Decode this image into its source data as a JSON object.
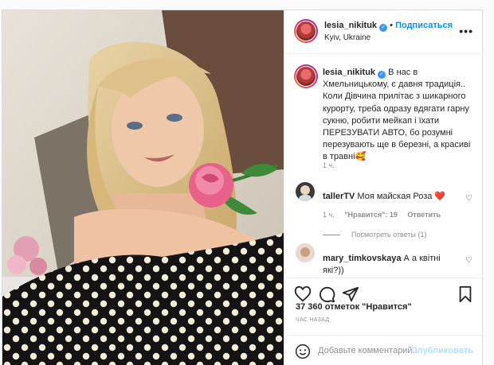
{
  "post": {
    "author": {
      "username": "lesia_nikituk",
      "location": "Kyiv, Ukraine",
      "follow_label": "Подписаться",
      "more_label": "•••"
    },
    "caption": {
      "username": "lesia_nikituk",
      "lines": [
        "В нас в",
        "Хмельницькому, є давня традиція..",
        "Коли Дівчина прилітає з шикарного",
        "курорту, треба одразу вдягати гарну",
        "сукню, робити мейкап і їхати",
        "ПЕРЕЗУВАТИ АВТО, бо розумні",
        "перезувають ще в березні, а красиві",
        "в травні🥰"
      ],
      "time": "1 ч."
    },
    "comments": [
      {
        "username": "tallerTV",
        "text": "Моя майская Роза ❤️",
        "time": "1 ч.",
        "likes": "\"Нравится\": 19",
        "reply_label": "Ответить"
      },
      {
        "username": "mary_timkovskaya",
        "text_lines": [
          "А а квітні",
          "які?))"
        ]
      }
    ],
    "view_replies": "Посмотреть ответы (1)",
    "likes_text": "37 360 отметок \"Нравится\"",
    "time_ago": "ЧАС НАЗАД",
    "add_comment_placeholder": "Добавьте комментарий...",
    "publish_label": "Опубликовать"
  },
  "icons": {
    "like": "heart-icon",
    "comment": "comment-icon",
    "share": "share-icon",
    "save": "bookmark-icon",
    "emoji": "emoji-icon"
  }
}
